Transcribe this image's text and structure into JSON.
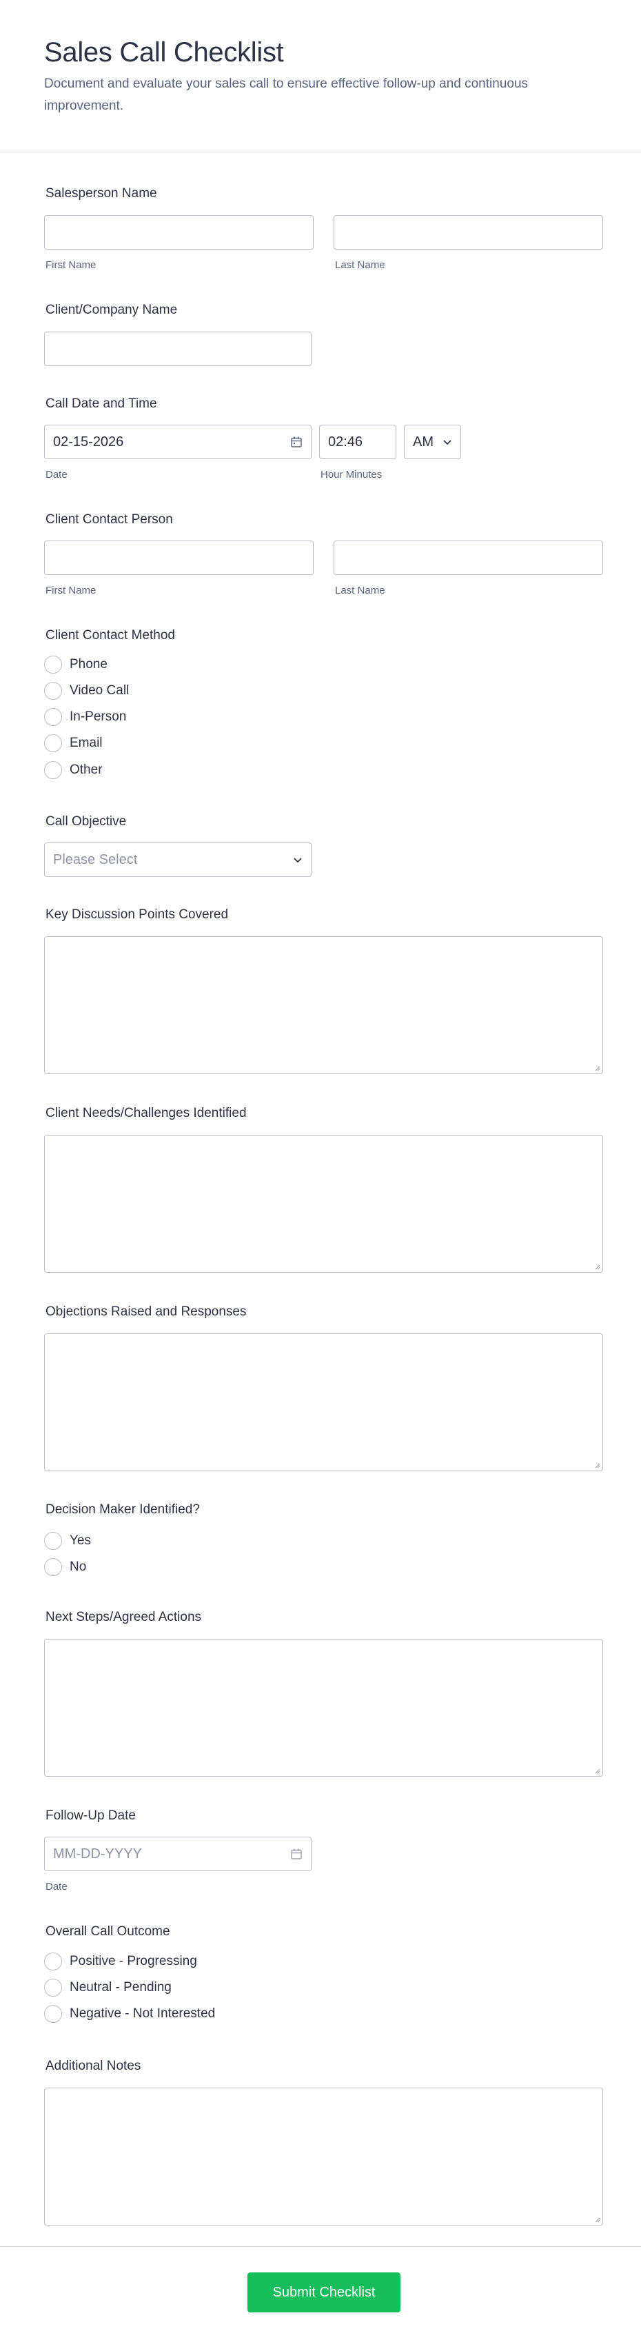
{
  "form": {
    "title": "Sales Call Checklist",
    "description": "Document and evaluate your sales call to ensure effective follow-up and continuous improvement."
  },
  "salesperson": {
    "label": "Salesperson Name",
    "first_sub": "First Name",
    "last_sub": "Last Name",
    "first_value": "",
    "last_value": ""
  },
  "client_company": {
    "label": "Client/Company Name",
    "value": ""
  },
  "call_datetime": {
    "label": "Call Date and Time",
    "date_value": "02-15-2026",
    "time_value": "02:46",
    "ampm_value": "AM",
    "date_sub": "Date",
    "time_sub": "Hour Minutes"
  },
  "contact_person": {
    "label": "Client Contact Person",
    "first_sub": "First Name",
    "last_sub": "Last Name"
  },
  "contact_method": {
    "label": "Client Contact Method",
    "options": [
      "Phone",
      "Video Call",
      "In-Person",
      "Email",
      "Other"
    ]
  },
  "objective": {
    "label": "Call Objective",
    "placeholder": "Please Select"
  },
  "discussion": {
    "label": "Key Discussion Points Covered"
  },
  "needs": {
    "label": "Client Needs/Challenges Identified"
  },
  "objections": {
    "label": "Objections Raised and Responses"
  },
  "decision_maker": {
    "label": "Decision Maker Identified?",
    "options": [
      "Yes",
      "No"
    ]
  },
  "next_steps": {
    "label": "Next Steps/Agreed Actions"
  },
  "followup": {
    "label": "Follow-Up Date",
    "placeholder": "MM-DD-YYYY",
    "sub": "Date"
  },
  "outcome": {
    "label": "Overall Call Outcome",
    "options": [
      "Positive - Progressing",
      "Neutral - Pending",
      "Negative - Not Interested"
    ]
  },
  "notes": {
    "label": "Additional Notes"
  },
  "submit_label": "Submit Checklist",
  "colors": {
    "accent": "#18bd5b",
    "text": "#2c3345",
    "muted": "#57647e",
    "border": "#b8bdc9"
  }
}
